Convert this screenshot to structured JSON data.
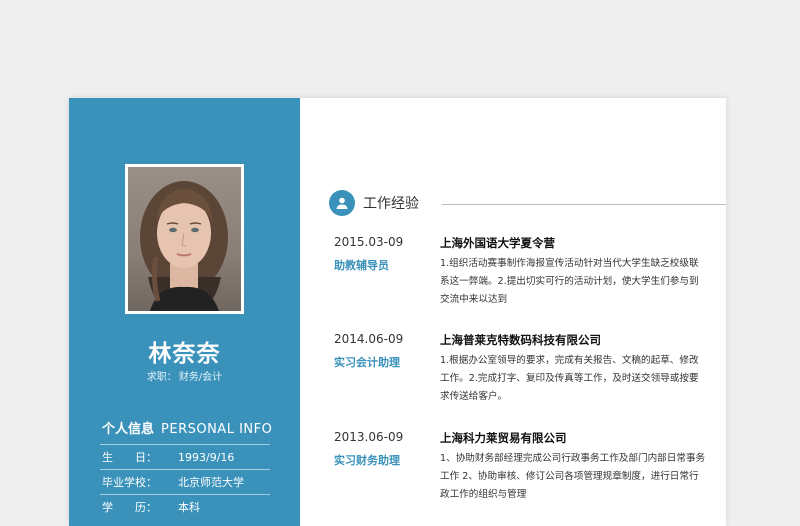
{
  "profile": {
    "name": "林奈奈",
    "job_label": "求职：",
    "job_value": "财务/会计"
  },
  "personal_info": {
    "title_cn": "个人信息",
    "title_en": "PERSONAL INFO",
    "rows": [
      {
        "label": "生　　日：",
        "value": "1993/9/16"
      },
      {
        "label": "毕业学校：",
        "value": "北京师范大学"
      },
      {
        "label": "学　　历：",
        "value": "本科"
      }
    ]
  },
  "experience": {
    "title": "工作经验",
    "icon": "user-icon",
    "entries": [
      {
        "date": "2015.03-09",
        "role": "助教辅导员",
        "company": "上海外国语大学夏令营",
        "description": "1.组织活动赛事制作海报宣传活动针对当代大学生缺乏校级联系这一弊端。2.提出切实可行的活动计划，使大学生们参与到交流中来以达到"
      },
      {
        "date": "2014.06-09",
        "role": "实习会计助理",
        "company": "上海普莱克特数码科技有限公司",
        "description": "1.根据办公室领导的要求，完成有关报告、文稿的起草、修改工作。2.完成打字、复印及传真等工作，及时送交领导或按要求传送给客户。"
      },
      {
        "date": "2013.06-09",
        "role": "实习财务助理",
        "company": "上海科力莱贸易有限公司",
        "description": "1、协助财务部经理完成公司行政事务工作及部门内部日常事务工作 2、协助审核、修订公司各项管理规章制度，进行日常行政工作的组织与管理"
      }
    ]
  },
  "colors": {
    "accent": "#3a92bb",
    "background": "#efefef"
  }
}
